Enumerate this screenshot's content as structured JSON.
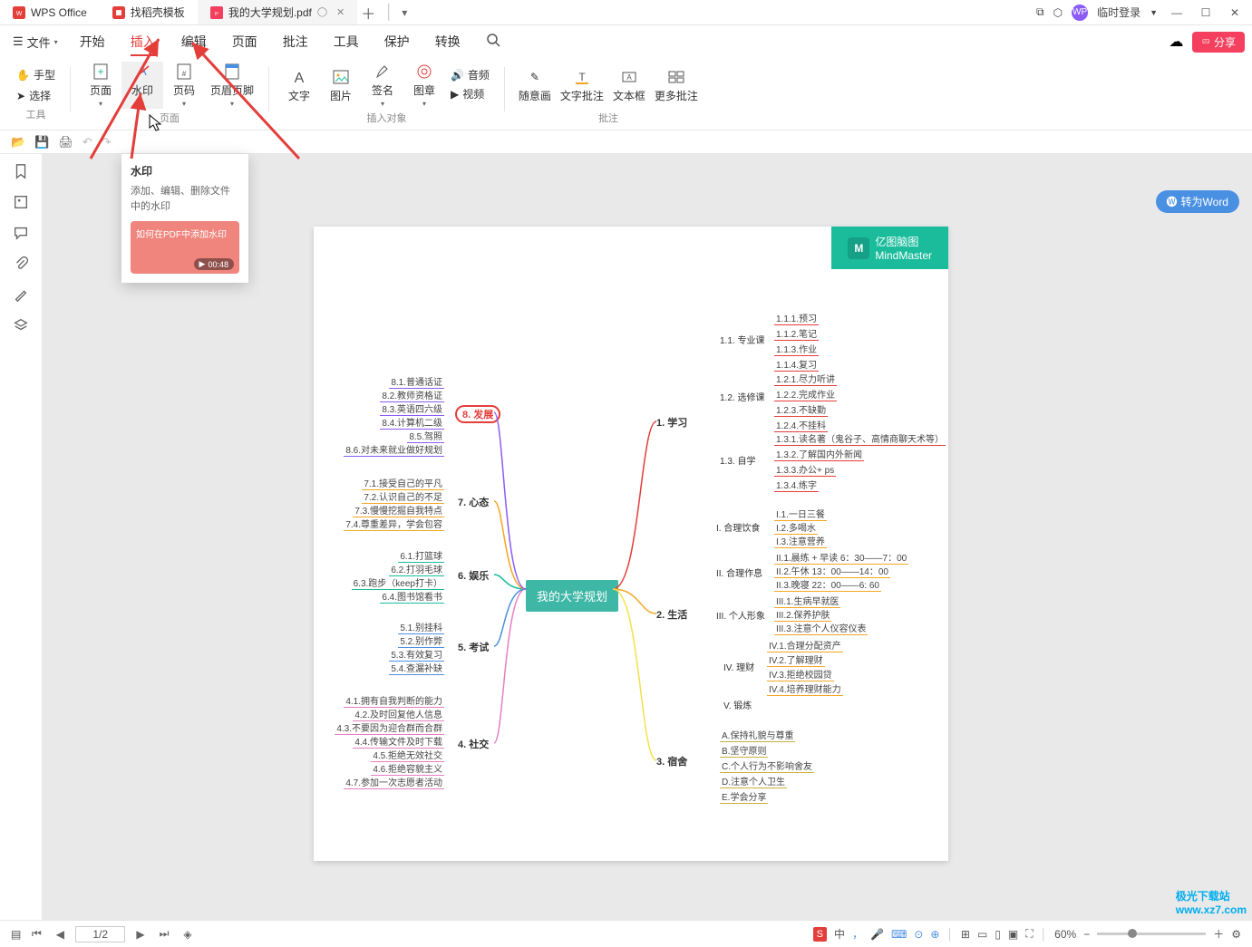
{
  "titlebar": {
    "app_name": "WPS Office",
    "tabs": [
      {
        "label": "找稻壳模板",
        "icon": "template"
      },
      {
        "label": "我的大学规划.pdf",
        "icon": "pdf",
        "active": true
      }
    ],
    "login_label": "临时登录",
    "avatar_text": "WP"
  },
  "menubar": {
    "file_label": "文件",
    "items": [
      "开始",
      "插入",
      "编辑",
      "页面",
      "批注",
      "工具",
      "保护",
      "转换"
    ],
    "active_index": 1,
    "share_label": "分享"
  },
  "ribbon": {
    "group_tools": {
      "label": "工具",
      "hand": "手型",
      "select": "选择"
    },
    "group_page": {
      "label": "页面",
      "page": "页面",
      "watermark": "水印",
      "pagenum": "页码",
      "headerfooter": "页眉页脚"
    },
    "group_insert": {
      "label": "插入对象",
      "text": "文字",
      "image": "图片",
      "sign": "签名",
      "stamp": "图章",
      "audio": "音频",
      "video": "视频"
    },
    "group_annot": {
      "label": "批注",
      "free": "随意画",
      "textannot": "文字批注",
      "textbox": "文本框",
      "more": "更多批注"
    }
  },
  "tooltip": {
    "title": "水印",
    "desc": "添加、编辑、删除文件中的水印",
    "thumb_title": "如何在PDF中添加水印",
    "duration": "00:48"
  },
  "convert_btn": "转为Word",
  "doc": {
    "center": "我的大学规划",
    "logo_cn": "亿图脑图",
    "logo_en": "MindMaster",
    "right": {
      "r1": {
        "label": "1. 学习",
        "c1": {
          "label": "1.1. 专业课",
          "leaves": [
            "1.1.1.预习",
            "1.1.2.笔记",
            "1.1.3.作业",
            "1.1.4.复习"
          ]
        },
        "c2": {
          "label": "1.2. 选修课",
          "leaves": [
            "1.2.1.尽力听讲",
            "1.2.2.完成作业",
            "1.2.3.不缺勤",
            "1.2.4.不挂科"
          ]
        },
        "c3": {
          "label": "1.3. 自学",
          "leaves": [
            "1.3.1.读名著（鬼谷子、高情商聊天术等）",
            "1.3.2.了解国内外新闻",
            "1.3.3.办公+ ps",
            "1.3.4.练字"
          ]
        }
      },
      "r2": {
        "label": "2. 生活",
        "c1": {
          "label": "I. 合理饮食",
          "leaves": [
            "I.1.一日三餐",
            "I.2.多喝水",
            "I.3.注意营养"
          ]
        },
        "c2": {
          "label": "II. 合理作息",
          "leaves": [
            "II.1.晨练 + 早读 6：30——7：00",
            "II.2.午休 13：00——14：00",
            "II.3.晚寝 22：00——6: 60"
          ]
        },
        "c3": {
          "label": "III. 个人形象",
          "leaves": [
            "III.1.生病早就医",
            "III.2.保养护肤",
            "III.3.注意个人仪容仪表"
          ]
        },
        "c4": {
          "label": "IV. 理财",
          "leaves": [
            "IV.1.合理分配资产",
            "IV.2.了解理财",
            "IV.3.拒绝校园贷",
            "IV.4.培养理财能力"
          ]
        },
        "c5": {
          "label": "V. 锻炼"
        }
      },
      "r3": {
        "label": "3. 宿舍",
        "leaves": [
          "A.保持礼貌与尊重",
          "B.坚守原则",
          "C.个人行为不影响舍友",
          "D.注意个人卫生",
          "E.学会分享"
        ]
      }
    },
    "left": {
      "l4": {
        "label": "4. 社交",
        "leaves": [
          "4.1.拥有自我判断的能力",
          "4.2.及时回复他人信息",
          "4.3.不要因为迎合群而合群",
          "4.4.传输文件及时下载",
          "4.5.拒绝无效社交",
          "4.6.拒绝容貌主义",
          "4.7.参加一次志愿者活动"
        ]
      },
      "l5": {
        "label": "5. 考试",
        "leaves": [
          "5.1.别挂科",
          "5.2.别作弊",
          "5.3.有效复习",
          "5.4.查漏补缺"
        ]
      },
      "l6": {
        "label": "6. 娱乐",
        "leaves": [
          "6.1.打篮球",
          "6.2.打羽毛球",
          "6.3.跑步（keep打卡）",
          "6.4.图书馆看书"
        ]
      },
      "l7": {
        "label": "7. 心态",
        "leaves": [
          "7.1.接受自己的平凡",
          "7.2.认识自己的不足",
          "7.3.慢慢挖掘自我特点",
          "7.4.尊重差异，学会包容"
        ]
      },
      "l8": {
        "label": "8. 发展",
        "leaves": [
          "8.1.普通话证",
          "8.2.教师资格证",
          "8.3.英语四六级",
          "8.4.计算机二级",
          "8.5.驾照",
          "8.6.对未来就业做好规划"
        ]
      }
    }
  },
  "status": {
    "page": "1/2",
    "zoom": "60%",
    "ime": "中"
  },
  "watermark_site": "www.xz7.com",
  "watermark_name": "极光下载站"
}
